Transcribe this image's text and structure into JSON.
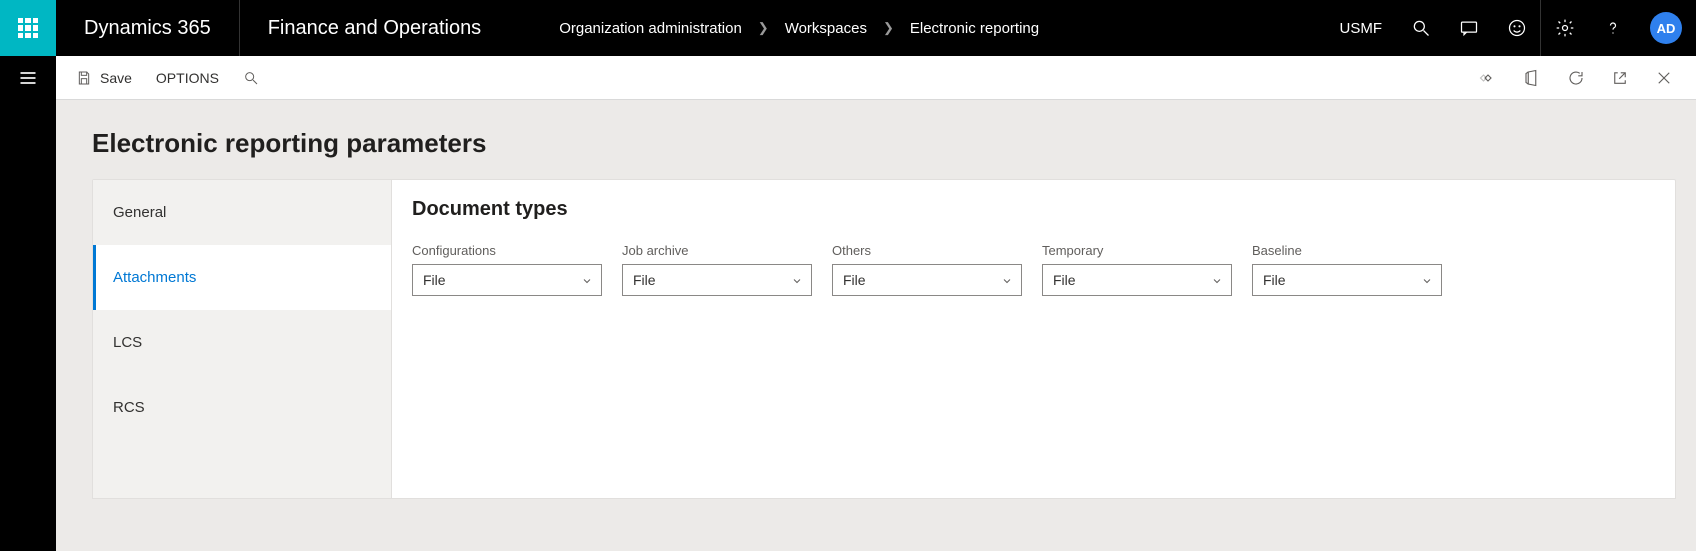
{
  "topbar": {
    "brand": "Dynamics 365",
    "module": "Finance and Operations",
    "breadcrumbs": [
      "Organization administration",
      "Workspaces",
      "Electronic reporting"
    ],
    "company": "USMF",
    "avatar": "AD"
  },
  "actionbar": {
    "save": "Save",
    "options": "OPTIONS"
  },
  "page": {
    "title": "Electronic reporting parameters",
    "tabs": [
      "General",
      "Attachments",
      "LCS",
      "RCS"
    ],
    "active_tab_index": 1
  },
  "section": {
    "title": "Document types",
    "fields": [
      {
        "label": "Configurations",
        "value": "File"
      },
      {
        "label": "Job archive",
        "value": "File"
      },
      {
        "label": "Others",
        "value": "File"
      },
      {
        "label": "Temporary",
        "value": "File"
      },
      {
        "label": "Baseline",
        "value": "File"
      }
    ]
  }
}
